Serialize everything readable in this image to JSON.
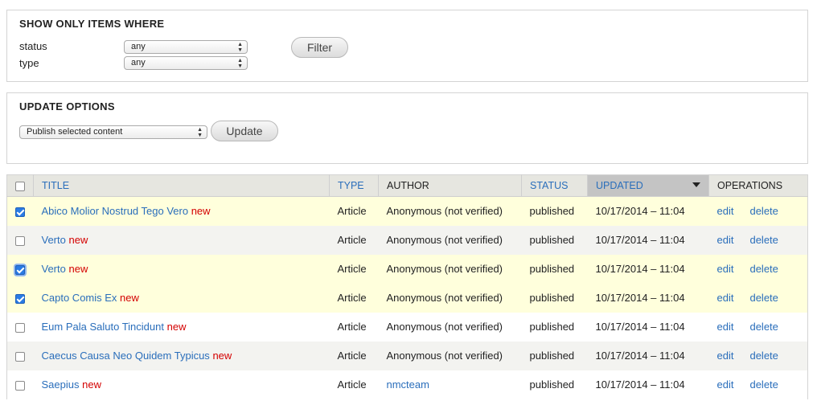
{
  "filter": {
    "title": "SHOW ONLY ITEMS WHERE",
    "status_label": "status",
    "status_value": "any",
    "type_label": "type",
    "type_value": "any",
    "filter_button": "Filter"
  },
  "update": {
    "title": "UPDATE OPTIONS",
    "action_value": "Publish selected content",
    "update_button": "Update"
  },
  "table": {
    "headers": {
      "title": "TITLE",
      "type": "TYPE",
      "author": "AUTHOR",
      "status": "STATUS",
      "updated": "UPDATED",
      "operations": "OPERATIONS"
    },
    "rows": [
      {
        "title": "Abico Molior Nostrud Tego Vero",
        "marker": "new",
        "type": "Article",
        "author": "Anonymous (not verified)",
        "status": "published",
        "updated": "10/17/2014 – 11:04",
        "edit": "edit",
        "delete": "delete",
        "checked": true
      },
      {
        "title": "Verto",
        "marker": "new",
        "type": "Article",
        "author": "Anonymous (not verified)",
        "status": "published",
        "updated": "10/17/2014 – 11:04",
        "edit": "edit",
        "delete": "delete",
        "checked": false
      },
      {
        "title": "Verto",
        "marker": "new",
        "type": "Article",
        "author": "Anonymous (not verified)",
        "status": "published",
        "updated": "10/17/2014 – 11:04",
        "edit": "edit",
        "delete": "delete",
        "checked": true
      },
      {
        "title": "Capto Comis Ex",
        "marker": "new",
        "type": "Article",
        "author": "Anonymous (not verified)",
        "status": "published",
        "updated": "10/17/2014 – 11:04",
        "edit": "edit",
        "delete": "delete",
        "checked": true
      },
      {
        "title": "Eum Pala Saluto Tincidunt",
        "marker": "new",
        "type": "Article",
        "author": "Anonymous (not verified)",
        "status": "published",
        "updated": "10/17/2014 – 11:04",
        "edit": "edit",
        "delete": "delete",
        "checked": false
      },
      {
        "title": "Caecus Causa Neo Quidem Typicus",
        "marker": "new",
        "type": "Article",
        "author": "Anonymous (not verified)",
        "status": "published",
        "updated": "10/17/2014 – 11:04",
        "edit": "edit",
        "delete": "delete",
        "checked": false
      },
      {
        "title": "Saepius",
        "marker": "new",
        "type": "Article",
        "author": "nmcteam",
        "status": "published",
        "updated": "10/17/2014 – 11:04",
        "edit": "edit",
        "delete": "delete",
        "checked": false
      }
    ]
  },
  "colors": {
    "link": "#2a6ebb",
    "new_marker": "#d40000",
    "selected_row": "#ffffdc",
    "header_bg": "#e6e6e0",
    "active_sort_bg": "#c4c4c4"
  },
  "icons": {
    "sort": "sort-descending-icon",
    "select_arrows": "select-arrows-icon",
    "checkbox": "checkbox"
  }
}
